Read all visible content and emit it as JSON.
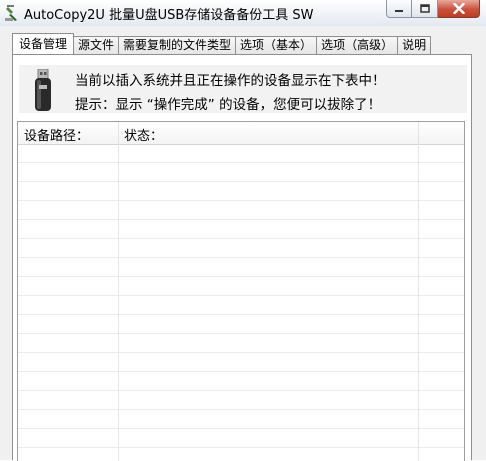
{
  "window": {
    "title": "AutoCopy2U 批量U盘USB存储设备备份工具 SW",
    "icons": [
      "app-icon",
      "minimize-icon",
      "maximize-icon",
      "close-icon"
    ]
  },
  "tabs": [
    {
      "label": "设备管理",
      "active": true
    },
    {
      "label": "源文件",
      "active": false
    },
    {
      "label": "需要复制的文件类型",
      "active": false
    },
    {
      "label": "选项（基本）",
      "active": false
    },
    {
      "label": "选项（高级）",
      "active": false
    },
    {
      "label": "说明",
      "active": false
    }
  ],
  "info": {
    "icon": "usb-drive-icon",
    "line1": "当前以插入系统并且正在操作的设备显示在下表中！",
    "line2": "提示：显示 “操作完成” 的设备，您便可以拔除了！"
  },
  "device_table": {
    "columns": [
      "设备路径：",
      "状态："
    ],
    "rows": []
  },
  "colors": {
    "close_button": "#c9513c",
    "panel_bg": "#ffffff",
    "info_bg": "#f2f2f2",
    "client_bg": "#f0f0f0"
  }
}
